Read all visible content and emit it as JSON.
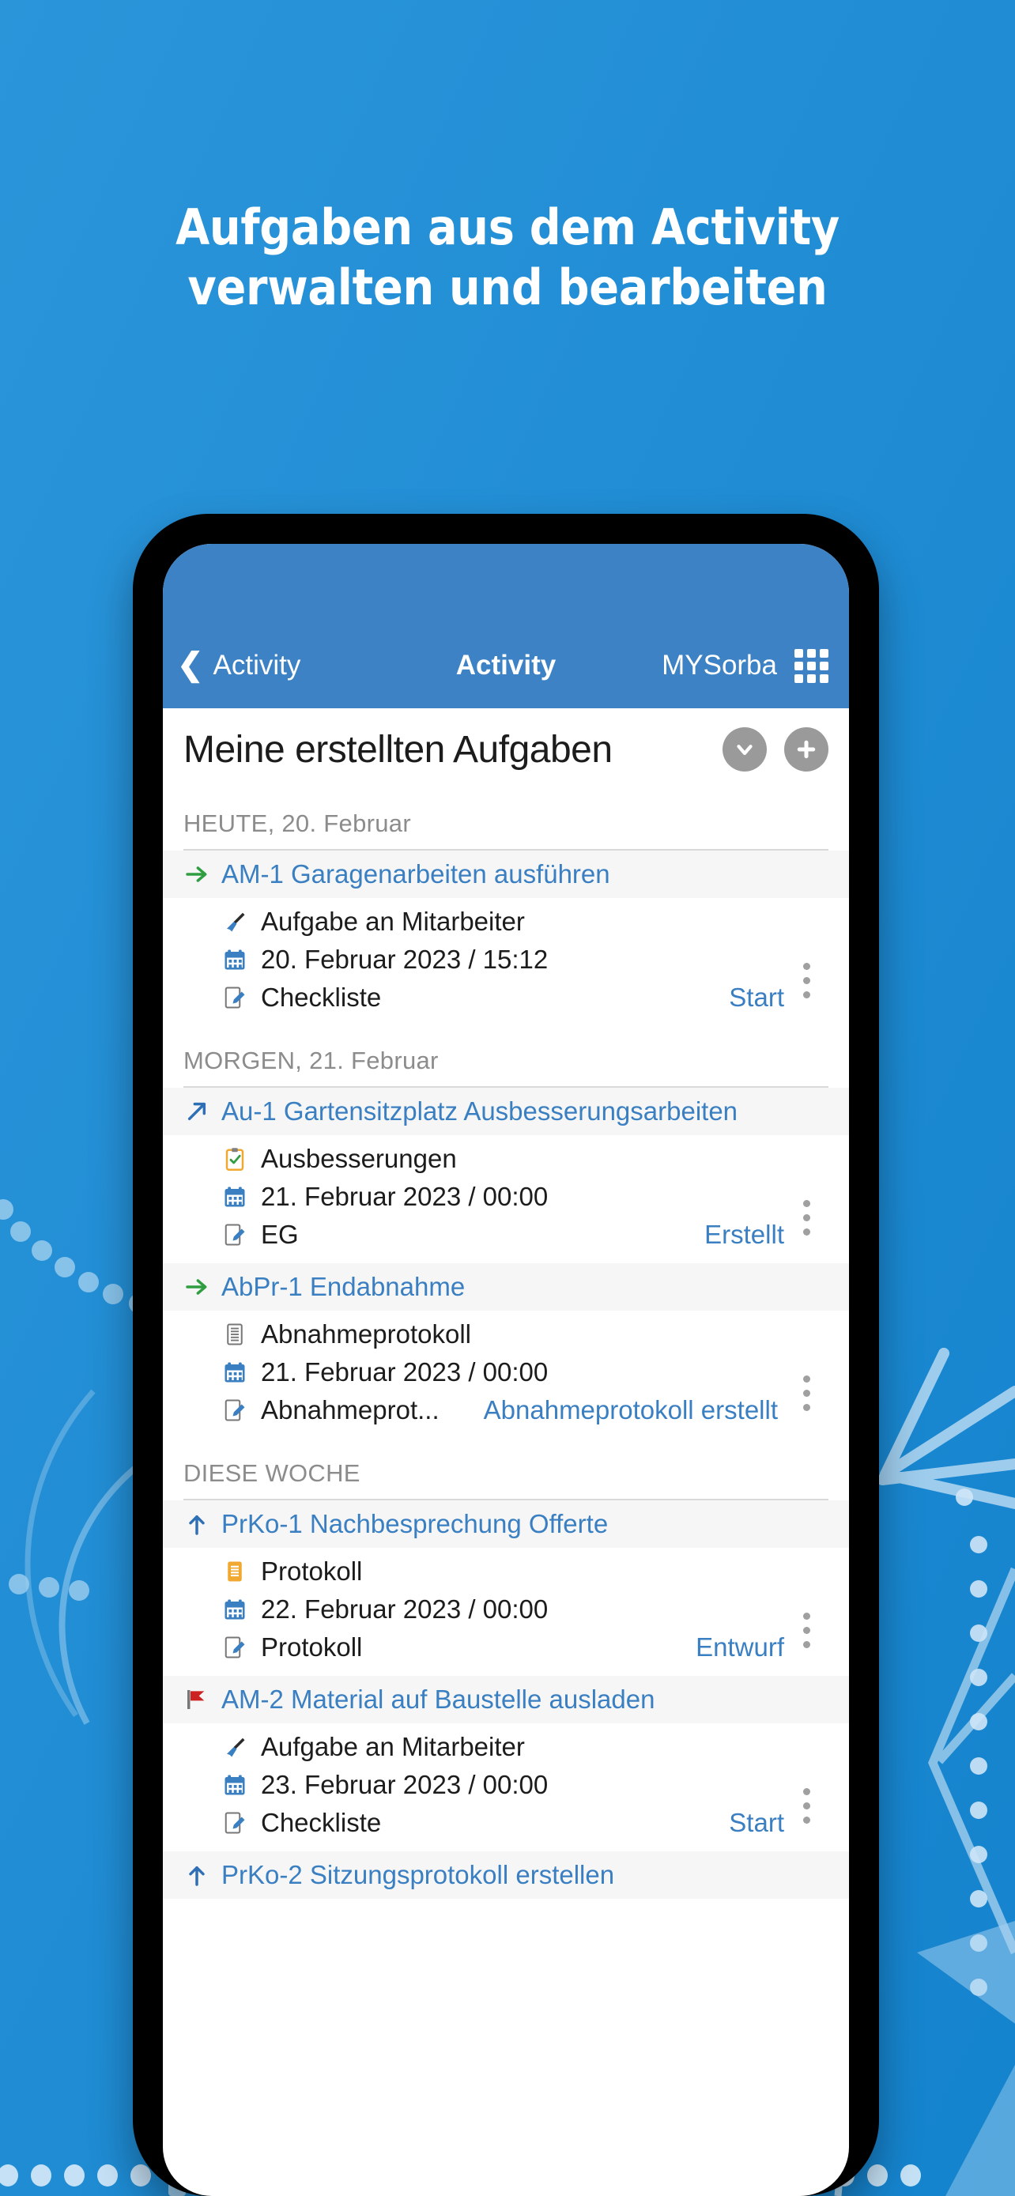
{
  "headline": {
    "line1": "Aufgaben aus dem Activity",
    "line2": "verwalten und bearbeiten"
  },
  "colors": {
    "background": "#1f8ad4",
    "navbar": "#3d82c4",
    "accent_link": "#3a7fc1",
    "arrow_green": "#2f9e41",
    "flag_red": "#cc2222",
    "muted_text": "#8c8c8c"
  },
  "navbar": {
    "back_label": "Activity",
    "back_icon": "chevron-left-icon",
    "title": "Activity",
    "right_label": "MYSorba",
    "grid_icon": "grid-apps-icon"
  },
  "page_header": {
    "title": "Meine erstellten Aufgaben",
    "collapse_icon": "chevron-down-icon",
    "add_icon": "plus-icon"
  },
  "sections": [
    {
      "label": "HEUTE, 20. Februar",
      "tasks": [
        {
          "status_icon": "arrow-right-green-icon",
          "title": "AM-1 Garagenarbeiten ausführen",
          "type_icon": "brush-icon",
          "type": "Aufgabe an Mitarbeiter",
          "date_icon": "calendar-icon",
          "date": "20. Februar 2023 / 15:12",
          "doc_icon": "note-edit-icon",
          "doc": "Checkliste",
          "status": "Start",
          "status_inline": false,
          "menu_icon": "kebab-menu-icon"
        }
      ]
    },
    {
      "label": "MORGEN, 21. Februar",
      "tasks": [
        {
          "status_icon": "arrow-up-right-blue-icon",
          "title": "Au-1 Gartensitzplatz Ausbesserungsarbeiten",
          "type_icon": "clipboard-check-icon",
          "type": "Ausbesserungen",
          "date_icon": "calendar-icon",
          "date": "21. Februar 2023 / 00:00",
          "doc_icon": "note-edit-icon",
          "doc": "EG",
          "status": "Erstellt",
          "status_inline": false,
          "menu_icon": "kebab-menu-icon"
        },
        {
          "status_icon": "arrow-right-green-icon",
          "title": "AbPr-1 Endabnahme",
          "type_icon": "document-lines-icon",
          "type": "Abnahmeprotokoll",
          "date_icon": "calendar-icon",
          "date": "21. Februar 2023 / 00:00",
          "doc_icon": "note-edit-icon",
          "doc": "Abnahmeprot...",
          "status": "Abnahmeprotokoll erstellt",
          "status_inline": true,
          "menu_icon": "kebab-menu-icon"
        }
      ]
    },
    {
      "label": "DIESE WOCHE",
      "tasks": [
        {
          "status_icon": "arrow-up-blue-icon",
          "title": "PrKo-1 Nachbesprechung Offerte",
          "type_icon": "document-orange-icon",
          "type": "Protokoll",
          "date_icon": "calendar-icon",
          "date": "22. Februar 2023 / 00:00",
          "doc_icon": "note-edit-icon",
          "doc": "Protokoll",
          "status": "Entwurf",
          "status_inline": false,
          "menu_icon": "kebab-menu-icon"
        },
        {
          "status_icon": "flag-red-icon",
          "title": "AM-2 Material auf Baustelle ausladen",
          "type_icon": "brush-icon",
          "type": "Aufgabe an Mitarbeiter",
          "date_icon": "calendar-icon",
          "date": "23. Februar 2023 / 00:00",
          "doc_icon": "note-edit-icon",
          "doc": "Checkliste",
          "status": "Start",
          "status_inline": false,
          "menu_icon": "kebab-menu-icon"
        },
        {
          "status_icon": "arrow-up-blue-icon",
          "title": "PrKo-2 Sitzungsprotokoll erstellen",
          "partial": true
        }
      ]
    }
  ]
}
